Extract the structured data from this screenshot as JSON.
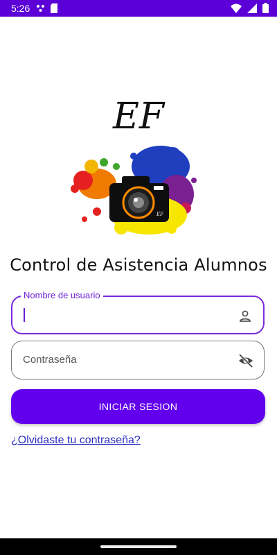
{
  "status_bar": {
    "time": "5:26",
    "icons": [
      "notification-dots-icon",
      "sd-card-icon",
      "wifi-icon",
      "signal-icon",
      "battery-icon"
    ],
    "color": "#5b00d6"
  },
  "logo": {
    "monogram": "EF",
    "camera_badge": "EF",
    "icon": "camera-paint-splash-icon"
  },
  "app_title": "Control de Asistencia Alumnos",
  "form": {
    "username": {
      "label": "Nombre de usuario",
      "value": "",
      "trailing_icon": "person-icon"
    },
    "password": {
      "placeholder": "Contraseña",
      "value": "",
      "trailing_icon": "eye-off-icon"
    }
  },
  "login_button": {
    "label": "INICIAR SESION",
    "color": "#6200ee"
  },
  "forgot_link": "¿Olvidaste tu contraseña?"
}
